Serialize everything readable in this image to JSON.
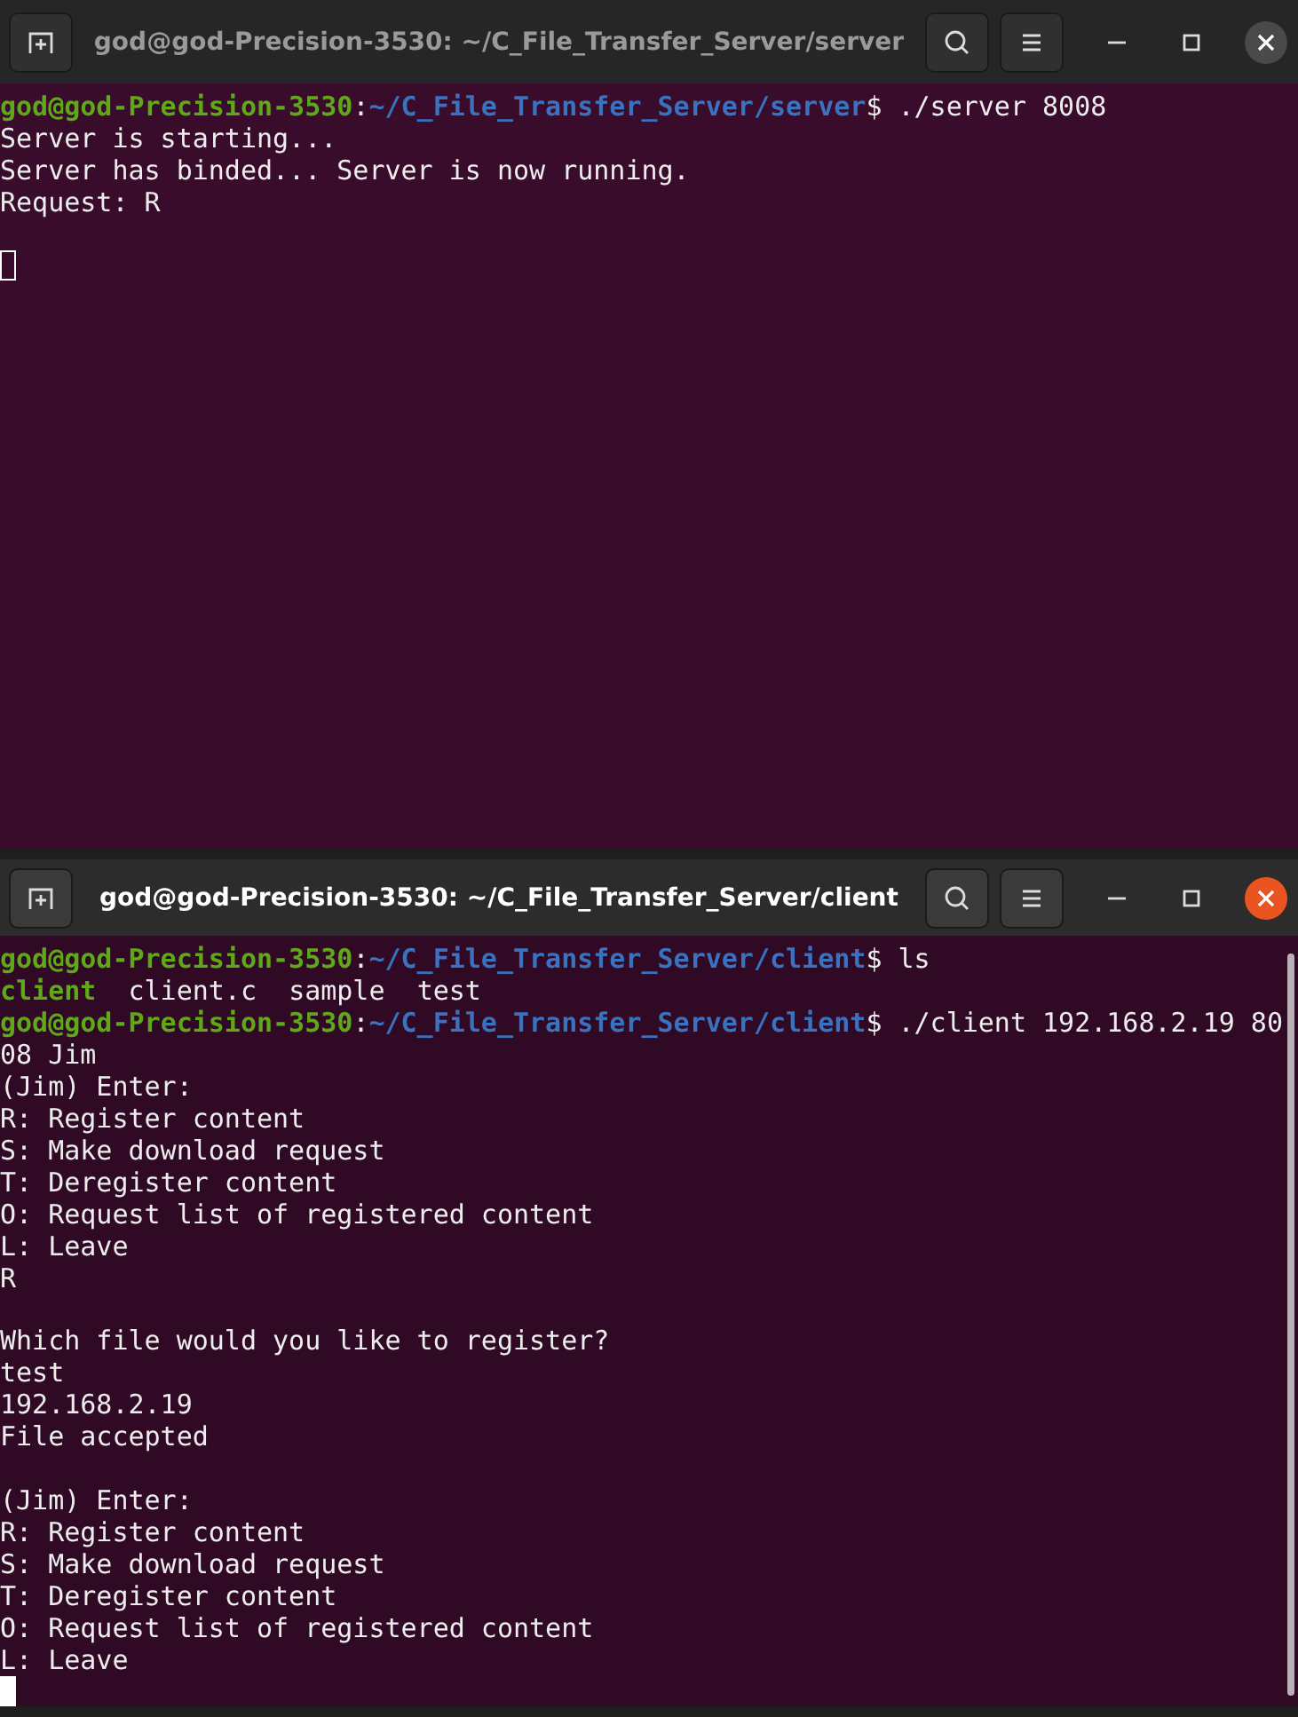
{
  "windows": [
    {
      "title": "god@god-Precision-3530: ~/C_File_Transfer_Server/server",
      "active": false,
      "scrollbar": false,
      "cursor": {
        "focused": false
      },
      "lines": [
        {
          "kind": "prompt",
          "user": "god@god-Precision-3530",
          "sep": ":",
          "path": "~/C_File_Transfer_Server/server",
          "dollar": "$",
          "command": " ./server 8008"
        },
        {
          "kind": "text",
          "text": "Server is starting..."
        },
        {
          "kind": "text",
          "text": "Server has binded... Server is now running."
        },
        {
          "kind": "text",
          "text": "Request: R"
        },
        {
          "kind": "blank"
        }
      ]
    },
    {
      "title": "god@god-Precision-3530: ~/C_File_Transfer_Server/client",
      "active": true,
      "scrollbar": true,
      "cursor": {
        "focused": true
      },
      "lines": [
        {
          "kind": "prompt",
          "user": "god@god-Precision-3530",
          "sep": ":",
          "path": "~/C_File_Transfer_Server/client",
          "dollar": "$",
          "command": " ls"
        },
        {
          "kind": "listing",
          "items": [
            {
              "text": "client",
              "executable": true
            },
            {
              "text": "client.c",
              "executable": false
            },
            {
              "text": "sample",
              "executable": false
            },
            {
              "text": "test",
              "executable": false
            }
          ]
        },
        {
          "kind": "prompt",
          "user": "god@god-Precision-3530",
          "sep": ":",
          "path": "~/C_File_Transfer_Server/client",
          "dollar": "$",
          "command": " ./client 192.168.2.19 80"
        },
        {
          "kind": "text",
          "text": "08 Jim"
        },
        {
          "kind": "text",
          "text": "(Jim) Enter:"
        },
        {
          "kind": "text",
          "text": "R: Register content"
        },
        {
          "kind": "text",
          "text": "S: Make download request"
        },
        {
          "kind": "text",
          "text": "T: Deregister content"
        },
        {
          "kind": "text",
          "text": "O: Request list of registered content"
        },
        {
          "kind": "text",
          "text": "L: Leave"
        },
        {
          "kind": "text",
          "text": "R"
        },
        {
          "kind": "blank"
        },
        {
          "kind": "text",
          "text": "Which file would you like to register?"
        },
        {
          "kind": "text",
          "text": "test"
        },
        {
          "kind": "text",
          "text": "192.168.2.19"
        },
        {
          "kind": "text",
          "text": "File accepted"
        },
        {
          "kind": "blank"
        },
        {
          "kind": "text",
          "text": "(Jim) Enter:"
        },
        {
          "kind": "text",
          "text": "R: Register content"
        },
        {
          "kind": "text",
          "text": "S: Make download request"
        },
        {
          "kind": "text",
          "text": "T: Deregister content"
        },
        {
          "kind": "text",
          "text": "O: Request list of registered content"
        },
        {
          "kind": "text",
          "text": "L: Leave"
        }
      ]
    }
  ]
}
